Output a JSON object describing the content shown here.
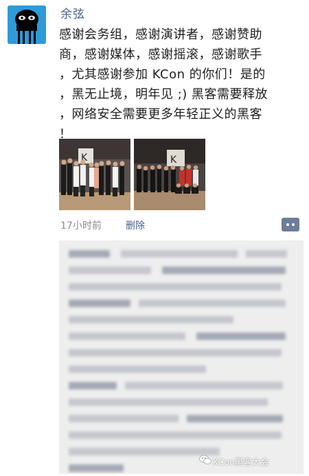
{
  "post": {
    "author": "余弦",
    "lines": [
      "感谢会务组，感谢演讲者，感谢赞助",
      "商，感谢媒体，感谢摇滚，感谢歌手",
      "，尤其感谢参加 KCon 的你们！是的",
      "，黑无止境，明年见 ;) 黑客需要释放",
      "，网络安全需要更多年轻正义的黑客",
      "！"
    ],
    "time": "17小时前",
    "delete_label": "删除"
  },
  "icons": {
    "avatar": "alien-avatar-icon",
    "comment": "comment-dots-icon",
    "watermark": "wechat-icon"
  },
  "watermark": {
    "text": "KCon黑客大会"
  },
  "colors": {
    "name_link": "#4a5f8c",
    "avatar_bg": "#2f9ad8",
    "comment_btn": "#6d7c99",
    "comments_bg": "#eeeeee"
  }
}
